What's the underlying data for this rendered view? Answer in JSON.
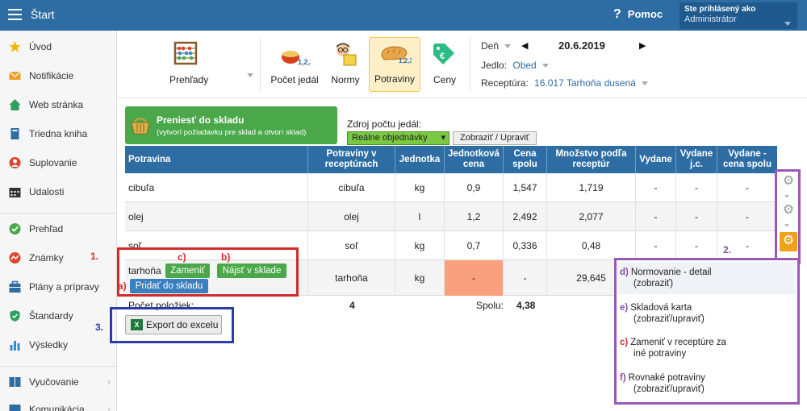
{
  "header": {
    "menu_icon": "hamburger-icon",
    "title": "Štart",
    "help_label": "Pomoc",
    "user_line1": "Ste prihlásený ako",
    "user_line2": "Administrátor"
  },
  "sidebar": {
    "items": [
      {
        "label": "Úvod",
        "icon": "star-icon",
        "color": "#f5b800"
      },
      {
        "label": "Notifikácie",
        "icon": "envelope-icon",
        "color": "#f0a024"
      },
      {
        "label": "Web stránka",
        "icon": "home-icon",
        "color": "#2e9f5e"
      },
      {
        "label": "Triedna kniha",
        "icon": "book-icon",
        "color": "#2d6da3"
      },
      {
        "label": "Suplovanie",
        "icon": "user-icon",
        "color": "#e0452f"
      },
      {
        "label": "Udalosti",
        "icon": "calendar-icon",
        "color": "#333333"
      },
      {
        "label": "Prehľad",
        "icon": "check-circle-icon",
        "color": "#4aa84a"
      },
      {
        "label": "Známky",
        "icon": "chart-circle-icon",
        "color": "#e0452f"
      },
      {
        "label": "Plány a prípravy",
        "icon": "briefcase-icon",
        "color": "#2d6da3"
      },
      {
        "label": "Štandardy",
        "icon": "shield-icon",
        "color": "#2e9f5e"
      },
      {
        "label": "Výsledky",
        "icon": "bar-chart-icon",
        "color": "#2d8fd0"
      },
      {
        "label": "Vyučovanie",
        "icon": "book-open-icon",
        "color": "#2d6da3"
      },
      {
        "label": "Komunikácia",
        "icon": "chat-icon",
        "color": "#2d6da3"
      }
    ]
  },
  "toolbar": {
    "prehlady": "Prehľady",
    "pocet_jedal": "Počet jedál",
    "normy": "Normy",
    "potraviny": "Potraviny",
    "ceny": "Ceny"
  },
  "filters": {
    "den_label": "Deň",
    "date": "20.6.2019",
    "jedlo_label": "Jedlo:",
    "jedlo_value": "Obed",
    "receptura_label": "Receptúra:",
    "receptura_value": "16.017 Tarhoňa dusená"
  },
  "transfer": {
    "title": "Preniesť do skladu",
    "subtitle": "(vytvorí požiadavku pre sklad a otvorí sklad)"
  },
  "source": {
    "label": "Zdroj počtu jedál:",
    "selected": "Reálne objednávky",
    "button": "Zobraziť / Upraviť"
  },
  "table": {
    "headers": [
      "Potravina",
      "Potraviny v receptúrach",
      "Jednotka",
      "Jednotková cena",
      "Cena spolu",
      "Množstvo podľa receptúr",
      "Vydane",
      "Vydane j.c.",
      "Vydane - cena spolu"
    ],
    "rows": [
      [
        "cibuľa",
        "cibuľa",
        "kg",
        "0,9",
        "1,547",
        "1,719",
        "-",
        "-",
        "-"
      ],
      [
        "olej",
        "olej",
        "l",
        "1,2",
        "2,492",
        "2,077",
        "-",
        "-",
        "-"
      ],
      [
        "soľ",
        "soľ",
        "kg",
        "0,7",
        "0,336",
        "0,48",
        "-",
        "-",
        "-"
      ],
      [
        "tarhoňa",
        "tarhoňa",
        "kg",
        "-",
        "-",
        "29,645",
        "",
        "",
        ""
      ]
    ],
    "row_buttons": {
      "zamenit": "Zameniť",
      "najst": "Nájsť v sklade",
      "pridat": "Pridať do skladu"
    },
    "summary_label": "Počet položiek:",
    "summary_count": "4",
    "total_label": "Spolu:",
    "total_value": "4,38"
  },
  "export": {
    "label": "Export do excelu"
  },
  "annotations": {
    "n1": "1.",
    "n2": "2.",
    "n3": "3.",
    "a": "a)",
    "b": "b)",
    "c": "c)"
  },
  "popup": {
    "items": [
      {
        "key": "d)",
        "line1": "Normovanie - detail",
        "line2": "(zobraziť)"
      },
      {
        "key": "e)",
        "line1": "Skladová karta",
        "line2": "(zobraziť/upraviť)"
      },
      {
        "key": "c)",
        "line1": "Zameniť v receptúre za",
        "line2": "iné potraviny"
      },
      {
        "key": "f)",
        "line1": "Rovnaké potraviny",
        "line2": "(zobraziť/upraviť)"
      }
    ]
  },
  "colors": {
    "header_blue": "#2d6da3",
    "green": "#4aa84a",
    "highlight": "#f9a07e",
    "annot_red": "#d42a2a",
    "annot_navy": "#2b3ba8",
    "annot_purple": "#8b4da8"
  }
}
